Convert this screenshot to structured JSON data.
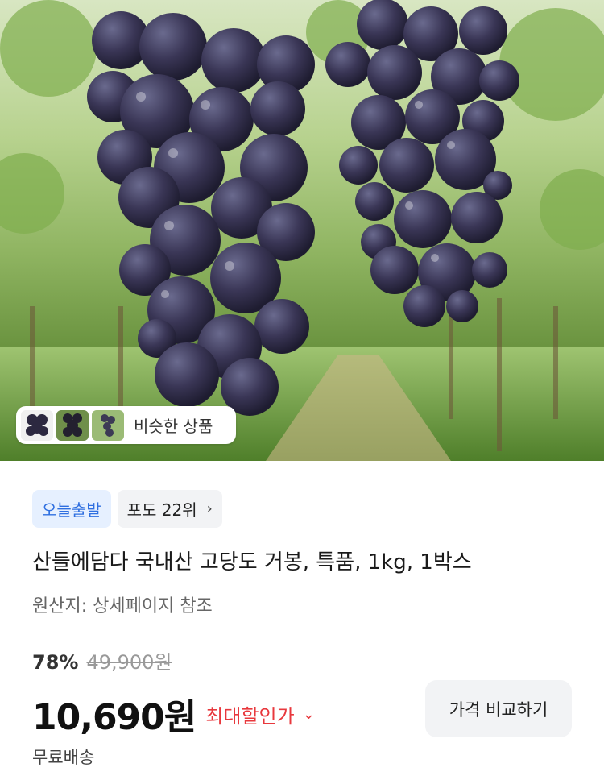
{
  "similar_products": {
    "label": "비슷한 상품"
  },
  "badges": {
    "today_ship": "오늘출발",
    "rank": "포도 22위"
  },
  "product": {
    "title": "산들에담다 국내산 고당도 거봉, 특품, 1kg, 1박스",
    "origin": "원산지: 상세페이지 참조",
    "discount": "78%",
    "original_price": "49,900원",
    "price": "10,690원",
    "max_discount_label": "최대할인가",
    "shipping": "무료배송"
  },
  "actions": {
    "compare_label": "가격 비교하기"
  },
  "colors": {
    "accent_red": "#e8383d",
    "accent_blue": "#2f6fe0"
  }
}
